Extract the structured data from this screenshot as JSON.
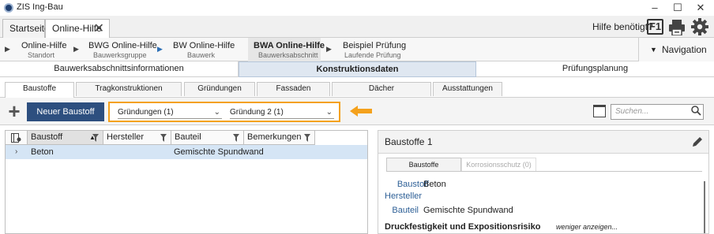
{
  "window": {
    "title": "ZIS Ing-Bau",
    "controls": [
      "–",
      "☐",
      "✕"
    ]
  },
  "doc_tabs": [
    {
      "label": "Startseite"
    },
    {
      "label": "Online-Hilfe"
    }
  ],
  "help": {
    "label": "Hilfe benötigt?",
    "f1": "F1"
  },
  "breadcrumbs": [
    {
      "title": "Online-Hilfe",
      "sub": "Standort"
    },
    {
      "title": "BWG Online-Hilfe",
      "sub": "Bauwerksgruppe"
    },
    {
      "title": "BW Online-Hilfe",
      "sub": "Bauwerk"
    },
    {
      "title": "BWA Online-Hilfe",
      "sub": "Bauwerksabschnitt"
    },
    {
      "title": "Beispiel Prüfung",
      "sub": "Laufende Prüfung"
    }
  ],
  "navigation_label": "Navigation",
  "sections": [
    {
      "label": "Bauwerksabschnittsinformationen"
    },
    {
      "label": "Konstruktionsdaten"
    },
    {
      "label": "Prüfungsplanung"
    }
  ],
  "subtabs": [
    {
      "label": "Baustoffe"
    },
    {
      "label": "Tragkonstruktionen"
    },
    {
      "label": "Gründungen"
    },
    {
      "label": "Fassaden"
    },
    {
      "label": "Dächer"
    },
    {
      "label": "Ausstattungen"
    }
  ],
  "toolbar": {
    "new_label": "Neuer Baustoff",
    "filter1": "Gründungen (1)",
    "filter2": "Gründung 2 (1)",
    "search_placeholder": "Suchen...",
    "highlight_color": "#f4a11c"
  },
  "grid": {
    "columns": [
      {
        "label": "Baustoff"
      },
      {
        "label": "Hersteller"
      },
      {
        "label": "Bauteil"
      },
      {
        "label": "Bemerkungen"
      }
    ],
    "rows": [
      {
        "baustoff": "Beton",
        "hersteller": "",
        "bauteil": "Gemischte Spundwand",
        "bemerkungen": ""
      }
    ]
  },
  "detail": {
    "title": "Baustoffe 1",
    "tabs": [
      {
        "label": "Baustoffe"
      },
      {
        "label": "Korrosionsschutz (0)"
      }
    ],
    "fields": [
      {
        "label": "Baustoff",
        "value": "Beton"
      },
      {
        "label": "Hersteller",
        "value": ""
      },
      {
        "label": "Bauteil",
        "value": "Gemischte Spundwand"
      }
    ],
    "section_title": "Druckfestigkeit und Expositionsrisiko",
    "section_toggle": "weniger anzeigen..."
  }
}
